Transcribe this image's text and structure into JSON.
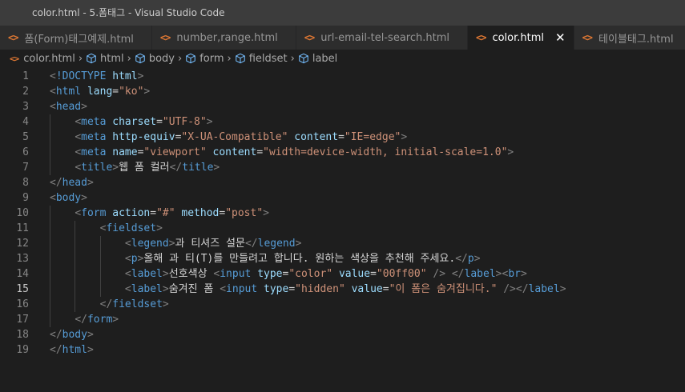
{
  "window": {
    "title": "color.html - 5.폼태그 - Visual Studio Code"
  },
  "tabs": [
    {
      "label": "폼(Form)태그예제.html",
      "active": false
    },
    {
      "label": "number,range.html",
      "active": false
    },
    {
      "label": "url-email-tel-search.html",
      "active": false
    },
    {
      "label": "color.html",
      "active": true
    },
    {
      "label": "테이블태그.html",
      "active": false
    }
  ],
  "tab_icon": "<>",
  "breadcrumb": [
    "color.html",
    "html",
    "body",
    "form",
    "fieldset",
    "label"
  ],
  "editor": {
    "current_line": 15,
    "lines": [
      {
        "n": "1",
        "indent": 0,
        "tokens": [
          [
            "br",
            "<"
          ],
          [
            "tag",
            "!DOCTYPE"
          ],
          [
            "txt",
            " "
          ],
          [
            "attr",
            "html"
          ],
          [
            "br",
            ">"
          ]
        ]
      },
      {
        "n": "2",
        "indent": 0,
        "tokens": [
          [
            "br",
            "<"
          ],
          [
            "tag",
            "html"
          ],
          [
            "txt",
            " "
          ],
          [
            "attr",
            "lang"
          ],
          [
            "txt",
            "="
          ],
          [
            "str",
            "\"ko\""
          ],
          [
            "br",
            ">"
          ]
        ]
      },
      {
        "n": "3",
        "indent": 0,
        "tokens": [
          [
            "br",
            "<"
          ],
          [
            "tag",
            "head"
          ],
          [
            "br",
            ">"
          ]
        ]
      },
      {
        "n": "4",
        "indent": 1,
        "tokens": [
          [
            "br",
            "<"
          ],
          [
            "tag",
            "meta"
          ],
          [
            "txt",
            " "
          ],
          [
            "attr",
            "charset"
          ],
          [
            "txt",
            "="
          ],
          [
            "str",
            "\"UTF-8\""
          ],
          [
            "br",
            ">"
          ]
        ]
      },
      {
        "n": "5",
        "indent": 1,
        "tokens": [
          [
            "br",
            "<"
          ],
          [
            "tag",
            "meta"
          ],
          [
            "txt",
            " "
          ],
          [
            "attr",
            "http-equiv"
          ],
          [
            "txt",
            "="
          ],
          [
            "str",
            "\"X-UA-Compatible\""
          ],
          [
            "txt",
            " "
          ],
          [
            "attr",
            "content"
          ],
          [
            "txt",
            "="
          ],
          [
            "str",
            "\"IE=edge\""
          ],
          [
            "br",
            ">"
          ]
        ]
      },
      {
        "n": "6",
        "indent": 1,
        "tokens": [
          [
            "br",
            "<"
          ],
          [
            "tag",
            "meta"
          ],
          [
            "txt",
            " "
          ],
          [
            "attr",
            "name"
          ],
          [
            "txt",
            "="
          ],
          [
            "str",
            "\"viewport\""
          ],
          [
            "txt",
            " "
          ],
          [
            "attr",
            "content"
          ],
          [
            "txt",
            "="
          ],
          [
            "str",
            "\"width=device-width, initial-scale=1.0\""
          ],
          [
            "br",
            ">"
          ]
        ]
      },
      {
        "n": "7",
        "indent": 1,
        "tokens": [
          [
            "br",
            "<"
          ],
          [
            "tag",
            "title"
          ],
          [
            "br",
            ">"
          ],
          [
            "txt",
            "웹 폼 컬러"
          ],
          [
            "br",
            "</"
          ],
          [
            "tag",
            "title"
          ],
          [
            "br",
            ">"
          ]
        ]
      },
      {
        "n": "8",
        "indent": 0,
        "tokens": [
          [
            "br",
            "</"
          ],
          [
            "tag",
            "head"
          ],
          [
            "br",
            ">"
          ]
        ]
      },
      {
        "n": "9",
        "indent": 0,
        "tokens": [
          [
            "br",
            "<"
          ],
          [
            "tag",
            "body"
          ],
          [
            "br",
            ">"
          ]
        ]
      },
      {
        "n": "10",
        "indent": 1,
        "tokens": [
          [
            "br",
            "<"
          ],
          [
            "tag",
            "form"
          ],
          [
            "txt",
            " "
          ],
          [
            "attr",
            "action"
          ],
          [
            "txt",
            "="
          ],
          [
            "str",
            "\"#\""
          ],
          [
            "txt",
            " "
          ],
          [
            "attr",
            "method"
          ],
          [
            "txt",
            "="
          ],
          [
            "str",
            "\"post\""
          ],
          [
            "br",
            ">"
          ]
        ]
      },
      {
        "n": "11",
        "indent": 2,
        "tokens": [
          [
            "br",
            "<"
          ],
          [
            "tag",
            "fieldset"
          ],
          [
            "br",
            ">"
          ]
        ]
      },
      {
        "n": "12",
        "indent": 3,
        "tokens": [
          [
            "br",
            "<"
          ],
          [
            "tag",
            "legend"
          ],
          [
            "br",
            ">"
          ],
          [
            "txt",
            "과 티셔즈 설문"
          ],
          [
            "br",
            "</"
          ],
          [
            "tag",
            "legend"
          ],
          [
            "br",
            ">"
          ]
        ]
      },
      {
        "n": "13",
        "indent": 3,
        "tokens": [
          [
            "br",
            "<"
          ],
          [
            "tag",
            "p"
          ],
          [
            "br",
            ">"
          ],
          [
            "txt",
            "올해 과 티(T)를 만들려고 합니다. 원하는 색상을 추천해 주세요."
          ],
          [
            "br",
            "</"
          ],
          [
            "tag",
            "p"
          ],
          [
            "br",
            ">"
          ]
        ]
      },
      {
        "n": "14",
        "indent": 3,
        "tokens": [
          [
            "br",
            "<"
          ],
          [
            "tag",
            "label"
          ],
          [
            "br",
            ">"
          ],
          [
            "txt",
            "선호색상 "
          ],
          [
            "br",
            "<"
          ],
          [
            "tag",
            "input"
          ],
          [
            "txt",
            " "
          ],
          [
            "attr",
            "type"
          ],
          [
            "txt",
            "="
          ],
          [
            "str",
            "\"color\""
          ],
          [
            "txt",
            " "
          ],
          [
            "attr",
            "value"
          ],
          [
            "txt",
            "="
          ],
          [
            "str",
            "\"00ff00\""
          ],
          [
            "txt",
            " "
          ],
          [
            "br",
            "/>"
          ],
          [
            "txt",
            " "
          ],
          [
            "br",
            "</"
          ],
          [
            "tag",
            "label"
          ],
          [
            "br",
            ">"
          ],
          [
            "br",
            "<"
          ],
          [
            "tag",
            "br"
          ],
          [
            "br",
            ">"
          ]
        ]
      },
      {
        "n": "15",
        "indent": 3,
        "tokens": [
          [
            "br",
            "<"
          ],
          [
            "tag",
            "label"
          ],
          [
            "br",
            ">"
          ],
          [
            "txt",
            "숨겨진 폼 "
          ],
          [
            "br",
            "<"
          ],
          [
            "tag",
            "input"
          ],
          [
            "txt",
            " "
          ],
          [
            "attr",
            "type"
          ],
          [
            "txt",
            "="
          ],
          [
            "str",
            "\"hidden\""
          ],
          [
            "txt",
            " "
          ],
          [
            "attr",
            "value"
          ],
          [
            "txt",
            "="
          ],
          [
            "str",
            "\"이 폼은 숨겨집니다.\""
          ],
          [
            "txt",
            " "
          ],
          [
            "br",
            "/>"
          ],
          [
            "br",
            "</"
          ],
          [
            "tag",
            "label"
          ],
          [
            "br",
            ">"
          ]
        ]
      },
      {
        "n": "16",
        "indent": 2,
        "tokens": [
          [
            "br",
            "</"
          ],
          [
            "tag",
            "fieldset"
          ],
          [
            "br",
            ">"
          ]
        ]
      },
      {
        "n": "17",
        "indent": 1,
        "tokens": [
          [
            "br",
            "</"
          ],
          [
            "tag",
            "form"
          ],
          [
            "br",
            ">"
          ]
        ]
      },
      {
        "n": "18",
        "indent": 0,
        "tokens": [
          [
            "br",
            "</"
          ],
          [
            "tag",
            "body"
          ],
          [
            "br",
            ">"
          ]
        ]
      },
      {
        "n": "19",
        "indent": 0,
        "tokens": [
          [
            "br",
            "</"
          ],
          [
            "tag",
            "html"
          ],
          [
            "br",
            ">"
          ]
        ]
      }
    ]
  },
  "colors": {
    "background": "#1e1e1e",
    "tag": "#569cd6",
    "attribute": "#9cdcfe",
    "string": "#ce9178",
    "html_icon": "#e37933"
  }
}
